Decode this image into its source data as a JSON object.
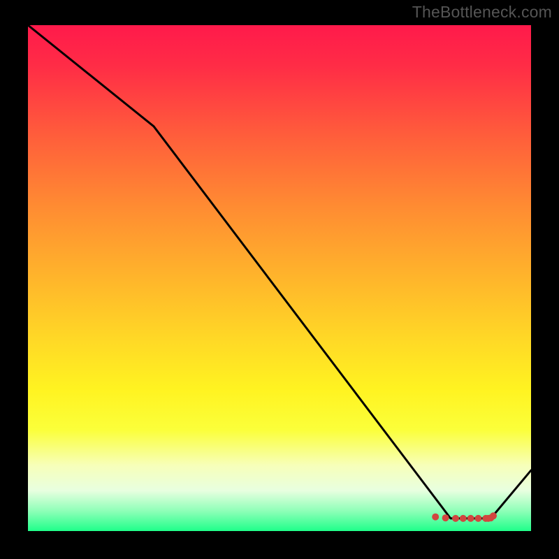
{
  "attribution": "TheBottleneck.com",
  "chart_data": {
    "type": "line",
    "title": "",
    "xlabel": "",
    "ylabel": "",
    "xlim": [
      0,
      100
    ],
    "ylim": [
      0,
      100
    ],
    "series": [
      {
        "name": "curve",
        "x": [
          0,
          25,
          84,
          92,
          100
        ],
        "values": [
          100,
          80,
          2.5,
          2.5,
          12
        ]
      }
    ],
    "markers": {
      "name": "highlight",
      "x": [
        81,
        83,
        85,
        86.5,
        88,
        89.5,
        91,
        91.5,
        92,
        92.5
      ],
      "values": [
        2.8,
        2.6,
        2.5,
        2.5,
        2.5,
        2.5,
        2.5,
        2.5,
        2.6,
        3.0
      ]
    },
    "gradient_stops": [
      {
        "pct": 0,
        "color": "#ff1a4b"
      },
      {
        "pct": 8,
        "color": "#ff2c46"
      },
      {
        "pct": 22,
        "color": "#ff5e3b"
      },
      {
        "pct": 36,
        "color": "#ff8c32"
      },
      {
        "pct": 50,
        "color": "#ffb52b"
      },
      {
        "pct": 62,
        "color": "#ffd826"
      },
      {
        "pct": 72,
        "color": "#fff321"
      },
      {
        "pct": 80,
        "color": "#fbff3a"
      },
      {
        "pct": 87,
        "color": "#f7ffb9"
      },
      {
        "pct": 92,
        "color": "#e8ffe0"
      },
      {
        "pct": 96,
        "color": "#8fffb8"
      },
      {
        "pct": 100,
        "color": "#1fff8a"
      }
    ]
  }
}
